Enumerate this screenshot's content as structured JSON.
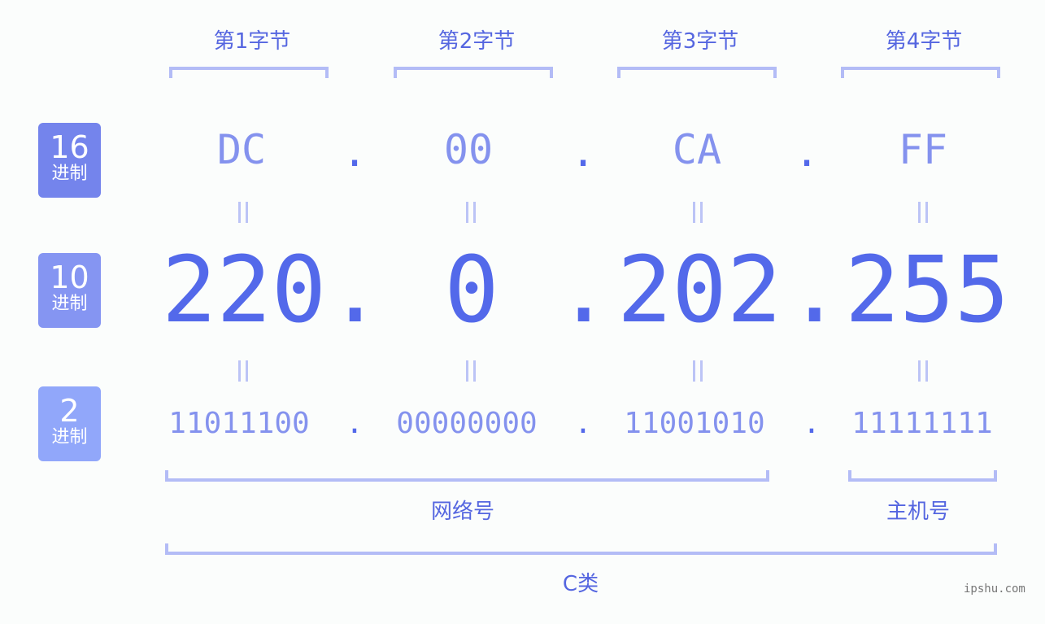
{
  "byte_labels": [
    "第1字节",
    "第2字节",
    "第3字节",
    "第4字节"
  ],
  "badges": {
    "hex": {
      "num": "16",
      "unit": "进制"
    },
    "dec": {
      "num": "10",
      "unit": "进制"
    },
    "bin": {
      "num": "2",
      "unit": "进制"
    }
  },
  "hex": [
    "DC",
    "00",
    "CA",
    "FF"
  ],
  "dec": [
    "220",
    "0",
    "202",
    "255"
  ],
  "bin": [
    "11011100",
    "00000000",
    "11001010",
    "11111111"
  ],
  "separator": ".",
  "network_label": "网络号",
  "host_label": "主机号",
  "class_label": "C类",
  "watermark": "ipshu.com",
  "colors": {
    "accent": "#5369ea",
    "light": "#8492ee",
    "bracket": "#b3bcf6",
    "badge_hex": "#7484ec",
    "badge_dec": "#8595f2",
    "badge_bin": "#91a7fa"
  }
}
